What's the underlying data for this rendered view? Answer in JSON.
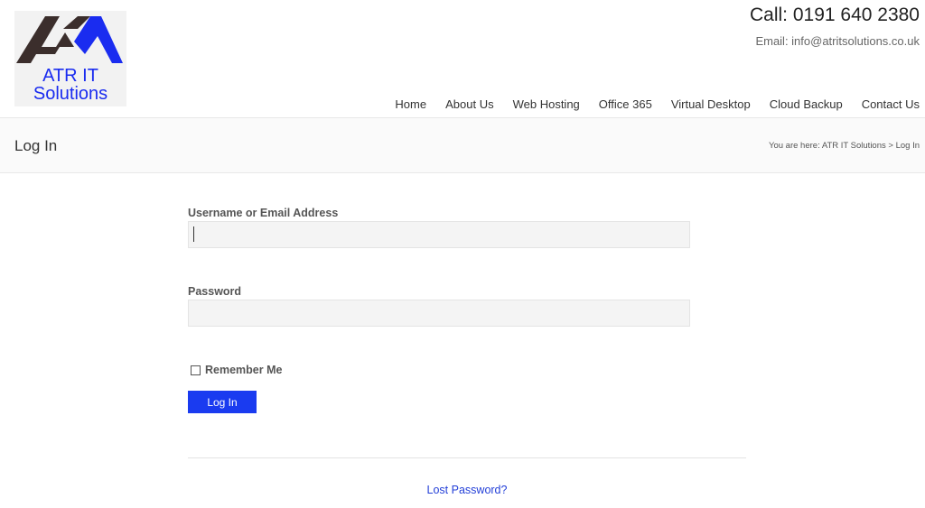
{
  "logo": {
    "line1": "ATR IT",
    "line2": "Solutions",
    "brand_color": "#1a2cf0",
    "mark_color": "#3b2e2c"
  },
  "header": {
    "phone": "Call: 0191 640 2380",
    "email": "Email: info@atritsolutions.co.uk"
  },
  "nav": {
    "items": [
      {
        "label": "Home"
      },
      {
        "label": "About Us"
      },
      {
        "label": "Web Hosting"
      },
      {
        "label": "Office 365"
      },
      {
        "label": "Virtual Desktop"
      },
      {
        "label": "Cloud Backup"
      },
      {
        "label": "Contact Us"
      }
    ]
  },
  "titlebar": {
    "title": "Log In",
    "breadcrumb": "You are here: ATR IT Solutions > Log In"
  },
  "form": {
    "username_label": "Username or Email Address",
    "username_value": "",
    "password_label": "Password",
    "password_value": "",
    "remember_label": "Remember Me",
    "remember_checked": false,
    "submit_label": "Log In",
    "button_color": "#1a3bf0",
    "lost_password": "Lost Password?"
  }
}
